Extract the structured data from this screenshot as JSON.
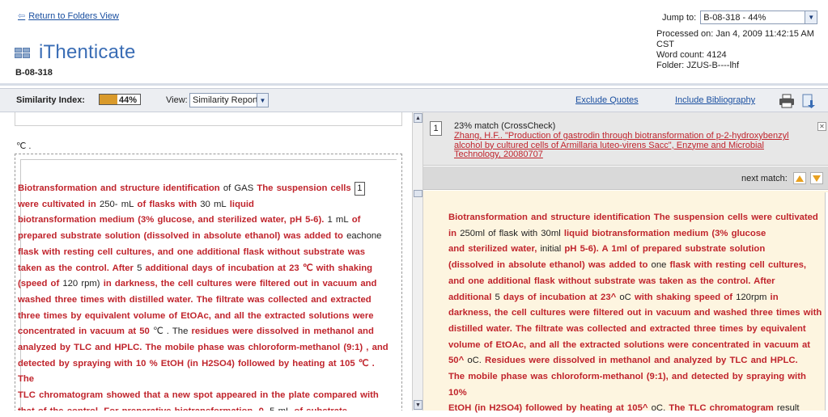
{
  "header": {
    "back_link": "Return to Folders View",
    "jump_label": "Jump to:",
    "jump_value": "B-08-318 - 44%",
    "processed": "Processed on: Jan 4, 2009 11:42:15 AM CST",
    "word_count": "Word count: 4124",
    "folder": "Folder: JZUS-B----lhf",
    "app_name": "iThenticate",
    "doc_id": "B-08-318"
  },
  "toolbar": {
    "similarity_label": "Similarity Index:",
    "similarity_value": "44%",
    "similarity_fraction": 0.44,
    "view_label": "View:",
    "view_value": "Similarity Report",
    "exclude_quotes": "Exclude Quotes",
    "include_bibliography": "Include Bibliography"
  },
  "left": {
    "degree_text": "℃ .",
    "marker": "1"
  },
  "right": {
    "match_number": "1",
    "match_pct": "23% match (CrossCheck)",
    "match_source": "Zhang, H.F.. \"Production of gastrodin through biotransformation of p-2-hydroxybenzyl alcohol by cultured cells of Armillaria luteo-virens Sacc\", Enzyme and Microbial Technology, 20080707",
    "next_match": "next match:"
  },
  "colors": {
    "match_red": "#c0242c",
    "similarity_bar": "#d99a2b",
    "source_bg": "#fdf5e0",
    "link_blue": "#1a4fa0"
  }
}
